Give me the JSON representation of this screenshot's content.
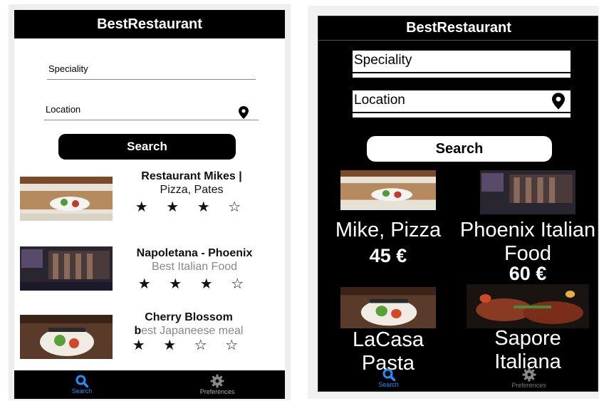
{
  "light": {
    "app_title": "BestRestaurant",
    "speciality_label": "Speciality",
    "location_label": "Location",
    "search_label": "Search",
    "results": [
      {
        "name": "Restaurant Mikes |",
        "desc": "Pizza, Pates",
        "stars": "★ ★ ★ ☆"
      },
      {
        "name": "Napoletana - Phoenix",
        "desc": "Best Italian Food",
        "stars": "★ ★ ★ ☆"
      },
      {
        "name": "Cherry Blossom",
        "desc_prefix": "b",
        "desc": "est Japaneese meal",
        "stars": "★ ★ ☆ ☆"
      }
    ],
    "tabs": {
      "search": "Search",
      "preferences": "Preferences"
    }
  },
  "dark": {
    "app_title": "BestRestaurant",
    "speciality_label": "Speciality",
    "location_label": "Location",
    "search_label": "Search",
    "cards": [
      {
        "name": "Mike, Pizza",
        "price": "45 €"
      },
      {
        "name": "Phoenix Italian Food",
        "price": "60 €"
      },
      {
        "name": "LaCasa Pasta",
        "price": ""
      },
      {
        "name": "Sapore Italiana",
        "price": ""
      }
    ],
    "tabs": {
      "search": "Search",
      "preferences": "Preferences"
    }
  },
  "colors": {
    "accent": "#1e90ff",
    "bar": "#000000"
  },
  "icons": [
    "location-pin-icon",
    "search-icon",
    "gear-icon"
  ]
}
